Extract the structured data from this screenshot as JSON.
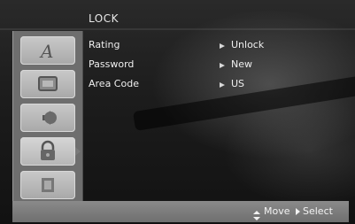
{
  "header": {
    "title": "LOCK"
  },
  "sidebar": {
    "items": [
      {
        "icon": "language-icon"
      },
      {
        "icon": "display-icon"
      },
      {
        "icon": "audio-icon"
      },
      {
        "icon": "lock-icon",
        "active": true
      },
      {
        "icon": "others-icon"
      }
    ]
  },
  "options": [
    {
      "label": "Rating",
      "value": "Unlock"
    },
    {
      "label": "Password",
      "value": "New"
    },
    {
      "label": "Area Code",
      "value": "US"
    }
  ],
  "footer": {
    "move_label": "Move",
    "select_label": "Select"
  },
  "colors": {
    "sidebar": "#6e6e6e",
    "tile": "#c0c0c0",
    "footer": "#7c7c7c",
    "text": "#efefef"
  }
}
